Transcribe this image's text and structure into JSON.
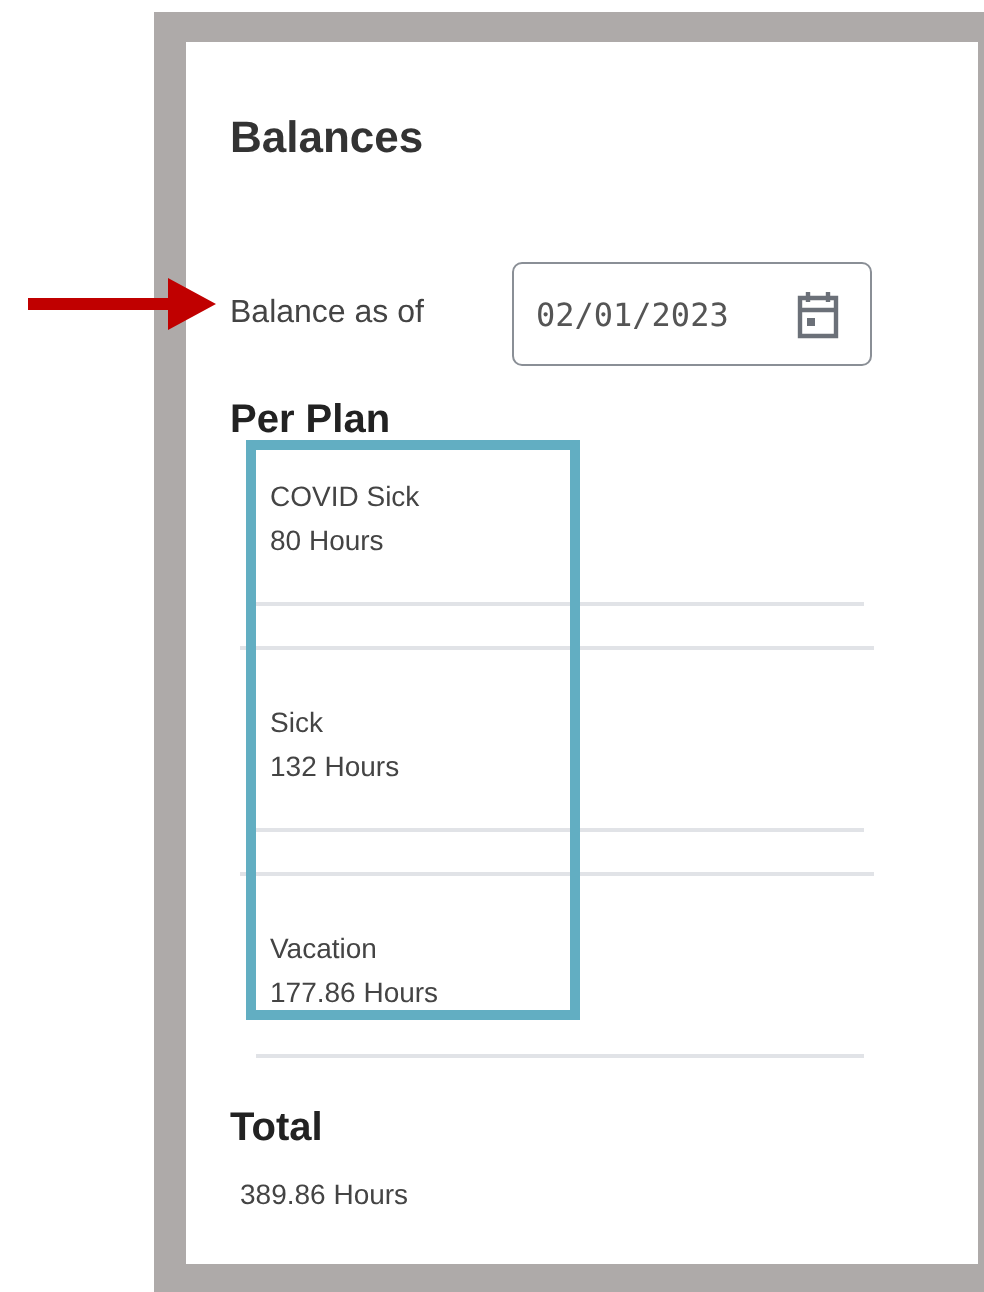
{
  "title": "Balances",
  "balance_date": {
    "label": "Balance as of",
    "value": "02/01/2023"
  },
  "per_plan": {
    "heading": "Per Plan",
    "plans": [
      {
        "name": "COVID Sick",
        "hours": "80 Hours"
      },
      {
        "name": "Sick",
        "hours": "132 Hours"
      },
      {
        "name": "Vacation",
        "hours": "177.86 Hours"
      }
    ]
  },
  "total": {
    "heading": "Total",
    "hours": "389.86 Hours"
  }
}
